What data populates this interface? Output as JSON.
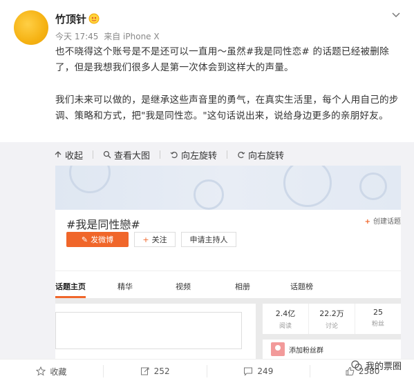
{
  "user": {
    "name": "竹顶针"
  },
  "meta": {
    "time": "今天 17:45",
    "source": "来自 iPhone X"
  },
  "post": {
    "paragraph1": "也不晓得这个账号是不是还可以一直用～虽然#我是同性恋# 的话题已经被删除了，但是我想我们很多人是第一次体会到这样大的声量。",
    "paragraph2": "我们未来可以做的，是继承这些声音里的勇气，在真实生活里，每个人用自己的步调、策略和方式，把\"我是同性恋。\"这句话说出来，说给身边更多的亲朋好友。"
  },
  "toolbar": {
    "collapse": "收起",
    "view_large": "查看大图",
    "rotate_left": "向左旋转",
    "rotate_right": "向右旋转"
  },
  "screenshot": {
    "topic_title": "#我是同性戀#",
    "create_topic": "创建话题",
    "post_button": "发微博",
    "follow_button": "关注",
    "host_button": "申请主持人",
    "tabs": [
      "话题主页",
      "精华",
      "视频",
      "相册",
      "话题榜"
    ],
    "stats": [
      {
        "num": "2.4亿",
        "label": "阅读"
      },
      {
        "num": "22.2万",
        "label": "讨论"
      },
      {
        "num": "25",
        "label": "粉丝"
      }
    ],
    "fans_group": "添加粉丝群"
  },
  "footer": {
    "favorite": "收藏",
    "repost_count": "252",
    "comment_count": "249",
    "like_count": "2580"
  },
  "watermark": "我的票圈",
  "colors": {
    "accent": "#f0662a",
    "avatar": "#f5b213"
  }
}
